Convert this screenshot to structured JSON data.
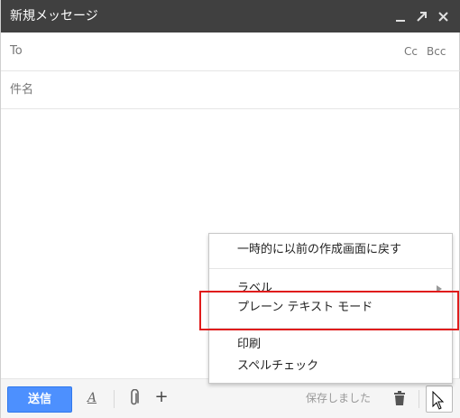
{
  "titlebar": {
    "title": "新規メッセージ",
    "minimize_icon": "minimize-icon",
    "expand_icon": "expand-icon",
    "close_icon": "close-icon"
  },
  "fields": {
    "to_label": "To",
    "cc_label": "Cc",
    "bcc_label": "Bcc",
    "subject_label": "件名"
  },
  "toolbar": {
    "send_label": "送信",
    "format_label": "A",
    "attach_icon": "paperclip-icon",
    "more_insert_label": "+",
    "saved_status": "保存しました",
    "trash_icon": "trash-icon",
    "more_options_icon": "triangle-up-icon"
  },
  "menu": {
    "items": [
      {
        "label": "一時的に以前の作成画面に戻す"
      },
      {
        "label": "ラベル",
        "has_submenu": true
      },
      {
        "label": "プレーン テキスト モード"
      },
      {
        "label": "印刷"
      },
      {
        "label": "スペルチェック"
      }
    ]
  },
  "colors": {
    "titlebar_bg": "#404040",
    "send_button": "#4d90fe",
    "highlight_box": "#e01c1c"
  }
}
